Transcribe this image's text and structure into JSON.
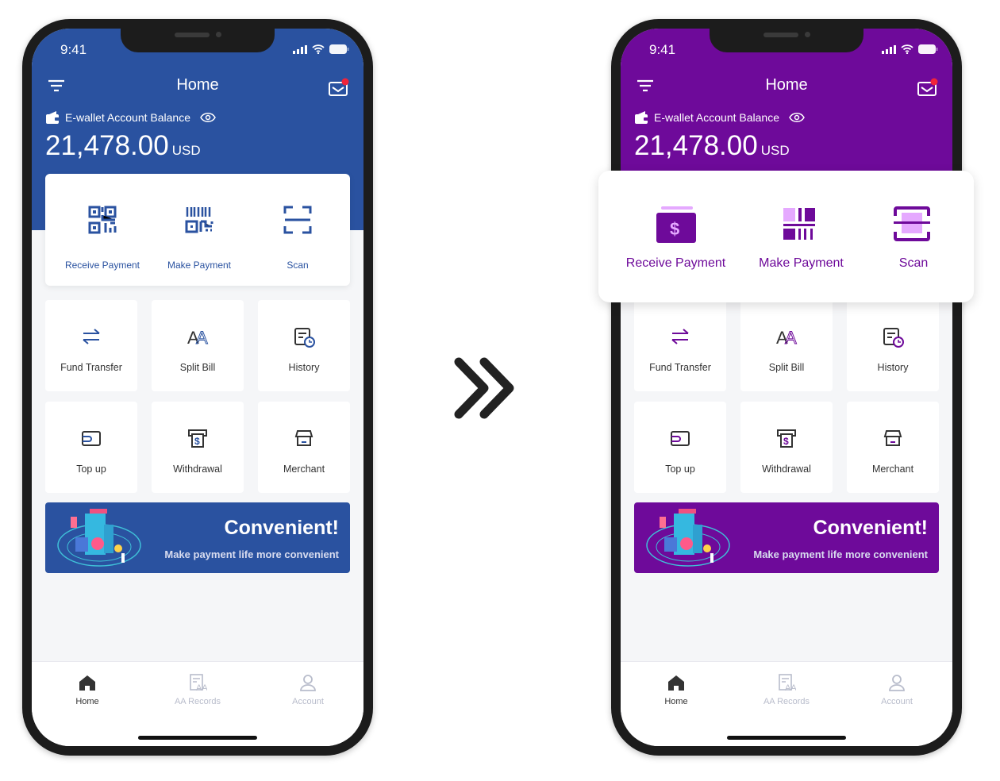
{
  "colors": {
    "blue": "#2a52a0",
    "purple": "#6e0a9a",
    "purple_light": "#e5a9ff"
  },
  "phones": [
    {
      "variant": "blue",
      "status_time": "9:41",
      "header": {
        "title": "Home",
        "menu_icon": "filter-icon",
        "mail_icon": "mail-icon",
        "notification_dot": true
      },
      "balance": {
        "label": "E-wallet Account Balance",
        "amount": "21,478.00",
        "currency": "USD"
      },
      "quick_actions": [
        {
          "label": "Receive Payment",
          "icon": "qr-code-icon"
        },
        {
          "label": "Make Payment",
          "icon": "barcode-icon"
        },
        {
          "label": "Scan",
          "icon": "scan-icon"
        }
      ],
      "services": [
        {
          "label": "Fund Transfer",
          "icon": "transfer-icon"
        },
        {
          "label": "Split Bill",
          "icon": "split-bill-icon"
        },
        {
          "label": "History",
          "icon": "history-icon"
        },
        {
          "label": "Top up",
          "icon": "top-up-icon"
        },
        {
          "label": "Withdrawal",
          "icon": "withdrawal-icon"
        },
        {
          "label": "Merchant",
          "icon": "merchant-icon"
        }
      ],
      "banner": {
        "title": "Convenient!",
        "subtitle": "Make payment life more convenient"
      },
      "tabs": [
        {
          "label": "Home",
          "icon": "home-icon",
          "active": true
        },
        {
          "label": "AA Records",
          "icon": "records-icon",
          "active": false
        },
        {
          "label": "Account",
          "icon": "account-icon",
          "active": false
        }
      ]
    },
    {
      "variant": "purple",
      "status_time": "9:41",
      "header": {
        "title": "Home",
        "menu_icon": "filter-icon",
        "mail_icon": "mail-icon",
        "notification_dot": true
      },
      "balance": {
        "label": "E-wallet Account Balance",
        "amount": "21,478.00",
        "currency": "USD"
      },
      "quick_actions": [
        {
          "label": "Receive Payment",
          "icon": "wallet-dollar-icon"
        },
        {
          "label": "Make Payment",
          "icon": "barcode-icon"
        },
        {
          "label": "Scan",
          "icon": "scan-icon"
        }
      ],
      "services": [
        {
          "label": "Fund Transfer",
          "icon": "transfer-icon"
        },
        {
          "label": "Split Bill",
          "icon": "split-bill-icon"
        },
        {
          "label": "History",
          "icon": "history-icon"
        },
        {
          "label": "Top up",
          "icon": "top-up-icon"
        },
        {
          "label": "Withdrawal",
          "icon": "withdrawal-icon"
        },
        {
          "label": "Merchant",
          "icon": "merchant-icon"
        }
      ],
      "banner": {
        "title": "Convenient!",
        "subtitle": "Make payment life more convenient"
      },
      "tabs": [
        {
          "label": "Home",
          "icon": "home-icon",
          "active": true
        },
        {
          "label": "AA Records",
          "icon": "records-icon",
          "active": false
        },
        {
          "label": "Account",
          "icon": "account-icon",
          "active": false
        }
      ]
    }
  ],
  "transition_icon": "double-chevron-right-icon"
}
